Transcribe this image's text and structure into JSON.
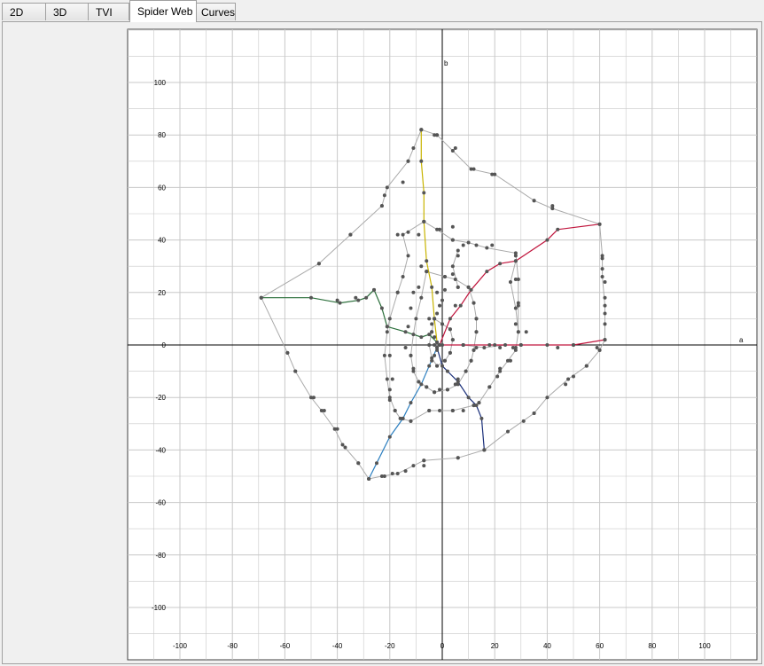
{
  "tabs": [
    {
      "label": "2D",
      "active": false
    },
    {
      "label": "3D",
      "active": false
    },
    {
      "label": "TVI",
      "active": false
    },
    {
      "label": "Spider Web",
      "active": true
    },
    {
      "label": "Curves",
      "active": false
    }
  ],
  "chart_data": {
    "type": "scatter",
    "title": "",
    "xlabel": "a",
    "ylabel": "b",
    "xlim": [
      -120,
      120
    ],
    "ylim": [
      -120,
      120
    ],
    "x_ticks": [
      -100,
      -80,
      -60,
      -40,
      -20,
      0,
      20,
      40,
      60,
      80,
      100
    ],
    "y_ticks": [
      100,
      80,
      60,
      40,
      20,
      0,
      -20,
      -40,
      -60,
      -80,
      -100
    ],
    "grid": true,
    "colors": {
      "grid": "#c8c8c8",
      "axis": "#000000",
      "web": "#aaaaaa",
      "point": "#555555",
      "yellow": "#c8b400",
      "red": "#c0143c",
      "green": "#2a6e3a",
      "blue": "#2c7fc0",
      "navy": "#1a2f7a"
    },
    "series": [
      {
        "color": "red",
        "points": [
          [
            -1,
            0
          ],
          [
            3,
            10
          ],
          [
            7,
            15
          ],
          [
            11,
            21
          ],
          [
            17,
            28
          ],
          [
            22,
            31
          ],
          [
            28,
            32
          ],
          [
            40,
            40
          ],
          [
            44,
            44
          ],
          [
            60,
            46
          ]
        ]
      },
      {
        "color": "red",
        "points": [
          [
            -1,
            0
          ],
          [
            8,
            0
          ],
          [
            20,
            0
          ],
          [
            40,
            0
          ],
          [
            50,
            0
          ],
          [
            62,
            2
          ]
        ]
      },
      {
        "color": "yellow",
        "points": [
          [
            -2,
            1
          ],
          [
            -3,
            10
          ],
          [
            -4,
            22
          ],
          [
            -6,
            32
          ],
          [
            -7,
            47
          ],
          [
            -7,
            58
          ],
          [
            -8,
            70
          ],
          [
            -8,
            82
          ]
        ]
      },
      {
        "color": "green",
        "points": [
          [
            -2,
            1
          ],
          [
            -5,
            4
          ],
          [
            -8,
            3
          ],
          [
            -14,
            5
          ],
          [
            -21,
            7
          ],
          [
            -23,
            14
          ],
          [
            -26,
            21
          ],
          [
            -29,
            18
          ],
          [
            -32,
            17
          ],
          [
            -39,
            16
          ],
          [
            -50,
            18
          ],
          [
            -69,
            18
          ]
        ]
      },
      {
        "color": "blue",
        "points": [
          [
            -2,
            -1
          ],
          [
            -5,
            -8
          ],
          [
            -8,
            -15
          ],
          [
            -12,
            -22
          ],
          [
            -15,
            -28
          ],
          [
            -20,
            -35
          ],
          [
            -25,
            -45
          ],
          [
            -28,
            -51
          ]
        ]
      },
      {
        "color": "navy",
        "points": [
          [
            -2,
            -1
          ],
          [
            0,
            -8
          ],
          [
            2,
            -10
          ],
          [
            6,
            -14
          ],
          [
            10,
            -20
          ],
          [
            13,
            -23
          ],
          [
            15,
            -28
          ],
          [
            16,
            -40
          ]
        ]
      },
      {
        "color": "web",
        "points": [
          [
            -69,
            18
          ],
          [
            -47,
            31
          ],
          [
            -35,
            42
          ],
          [
            -23,
            53
          ],
          [
            -21,
            60
          ],
          [
            -13,
            70
          ],
          [
            -8,
            82
          ],
          [
            -2,
            80
          ],
          [
            4,
            74
          ],
          [
            11,
            67
          ],
          [
            20,
            65
          ],
          [
            35,
            55
          ],
          [
            42,
            52
          ],
          [
            60,
            46
          ],
          [
            61,
            34
          ],
          [
            61,
            26
          ],
          [
            62,
            15
          ],
          [
            62,
            2
          ],
          [
            60,
            -2
          ],
          [
            55,
            -8
          ],
          [
            48,
            -13
          ],
          [
            40,
            -20
          ],
          [
            35,
            -26
          ],
          [
            25,
            -33
          ],
          [
            16,
            -40
          ],
          [
            6,
            -43
          ],
          [
            -7,
            -44
          ],
          [
            -11,
            -46
          ],
          [
            -17,
            -49
          ],
          [
            -23,
            -50
          ],
          [
            -28,
            -51
          ],
          [
            -32,
            -45
          ],
          [
            -38,
            -38
          ],
          [
            -41,
            -32
          ],
          [
            -46,
            -25
          ],
          [
            -50,
            -20
          ],
          [
            -56,
            -10
          ],
          [
            -59,
            -3
          ],
          [
            -69,
            18
          ]
        ]
      },
      {
        "color": "web",
        "points": [
          [
            -7,
            47
          ],
          [
            -2,
            44
          ],
          [
            4,
            40
          ],
          [
            10,
            39
          ],
          [
            17,
            37
          ],
          [
            28,
            35
          ],
          [
            29,
            25
          ],
          [
            29,
            15
          ],
          [
            29,
            5
          ],
          [
            28,
            -2
          ],
          [
            25,
            -6
          ],
          [
            22,
            -10
          ],
          [
            18,
            -16
          ],
          [
            14,
            -22
          ],
          [
            12,
            -23
          ],
          [
            4,
            -25
          ],
          [
            -5,
            -25
          ],
          [
            -12,
            -29
          ],
          [
            -16,
            -28
          ],
          [
            -18,
            -25
          ],
          [
            -20,
            -20
          ],
          [
            -21,
            -13
          ],
          [
            -22,
            -4
          ],
          [
            -21,
            5
          ],
          [
            -20,
            10
          ],
          [
            -17,
            20
          ],
          [
            -15,
            26
          ],
          [
            -13,
            34
          ],
          [
            -15,
            42
          ],
          [
            -7,
            47
          ]
        ]
      },
      {
        "color": "web",
        "points": [
          [
            -6,
            28
          ],
          [
            1,
            26
          ],
          [
            5,
            25
          ],
          [
            10,
            22
          ],
          [
            12,
            16
          ],
          [
            13,
            10
          ],
          [
            13,
            5
          ],
          [
            12,
            -2
          ],
          [
            11,
            -6
          ],
          [
            9,
            -10
          ],
          [
            6,
            -15
          ],
          [
            2,
            -17
          ],
          [
            -3,
            -18
          ],
          [
            -6,
            -16
          ],
          [
            -9,
            -14
          ],
          [
            -11,
            -10
          ],
          [
            -12,
            -4
          ],
          [
            -11,
            4
          ],
          [
            -10,
            10
          ],
          [
            -8,
            18
          ],
          [
            -6,
            28
          ]
        ]
      },
      {
        "color": "web",
        "points": [
          [
            -3,
            10
          ],
          [
            0,
            8
          ],
          [
            3,
            6
          ],
          [
            4,
            2
          ],
          [
            3,
            -3
          ],
          [
            1,
            -6
          ],
          [
            -2,
            -8
          ],
          [
            -4,
            -5
          ],
          [
            -5,
            0
          ],
          [
            -4,
            5
          ],
          [
            -3,
            10
          ]
        ]
      },
      {
        "color": "web",
        "points": [
          [
            0,
            0
          ],
          [
            8,
            0
          ],
          [
            16,
            -1
          ],
          [
            24,
            0
          ],
          [
            30,
            0
          ]
        ]
      },
      {
        "color": "web",
        "points": [
          [
            28,
            32
          ],
          [
            26,
            24
          ],
          [
            28,
            14
          ],
          [
            29,
            5
          ]
        ]
      },
      {
        "color": "web",
        "points": [
          [
            6,
            36
          ],
          [
            4,
            30
          ],
          [
            6,
            22
          ]
        ]
      }
    ],
    "extra_points": [
      [
        -8,
        82
      ],
      [
        -11,
        75
      ],
      [
        -13,
        70
      ],
      [
        -15,
        62
      ],
      [
        -22,
        57
      ],
      [
        -23,
        53
      ],
      [
        -35,
        42
      ],
      [
        -47,
        31
      ],
      [
        -40,
        17
      ],
      [
        -33,
        18
      ],
      [
        -26,
        21
      ],
      [
        -21,
        7
      ],
      [
        -17,
        20
      ],
      [
        -3,
        80
      ],
      [
        -2,
        80
      ],
      [
        5,
        75
      ],
      [
        12,
        67
      ],
      [
        19,
        65
      ],
      [
        35,
        55
      ],
      [
        42,
        53
      ],
      [
        61,
        33
      ],
      [
        61,
        29
      ],
      [
        62,
        24
      ],
      [
        62,
        18
      ],
      [
        62,
        12
      ],
      [
        62,
        8
      ],
      [
        62,
        2
      ],
      [
        60,
        -2
      ],
      [
        59,
        -1
      ],
      [
        55,
        -8
      ],
      [
        50,
        -12
      ],
      [
        47,
        -15
      ],
      [
        35,
        -26
      ],
      [
        31,
        -29
      ],
      [
        16,
        -40
      ],
      [
        6,
        -43
      ],
      [
        -7,
        -44
      ],
      [
        -7,
        -46
      ],
      [
        -14,
        -48
      ],
      [
        -19,
        -49
      ],
      [
        -22,
        -50
      ],
      [
        -28,
        -51
      ],
      [
        -32,
        -45
      ],
      [
        -37,
        -39
      ],
      [
        -40,
        -32
      ],
      [
        -45,
        -25
      ],
      [
        -49,
        -20
      ],
      [
        -56,
        -10
      ],
      [
        -59,
        -3
      ],
      [
        -17,
        42
      ],
      [
        -13,
        43
      ],
      [
        -9,
        42
      ],
      [
        -1,
        44
      ],
      [
        4,
        45
      ],
      [
        13,
        38
      ],
      [
        19,
        38
      ],
      [
        28,
        34
      ],
      [
        28,
        25
      ],
      [
        29,
        16
      ],
      [
        28,
        8
      ],
      [
        32,
        5
      ],
      [
        28,
        -1
      ],
      [
        26,
        -6
      ],
      [
        22,
        -9
      ],
      [
        21,
        -12
      ],
      [
        18,
        -16
      ],
      [
        14,
        -22
      ],
      [
        12,
        -23
      ],
      [
        8,
        -25
      ],
      [
        4,
        -25
      ],
      [
        -1,
        -25
      ],
      [
        -5,
        -25
      ],
      [
        -12,
        -29
      ],
      [
        -15,
        -28
      ],
      [
        -18,
        -25
      ],
      [
        -20,
        -21
      ],
      [
        -20,
        -17
      ],
      [
        -19,
        -13
      ],
      [
        -20,
        -4
      ],
      [
        -14,
        -1
      ],
      [
        -13,
        7
      ],
      [
        -12,
        14
      ],
      [
        -11,
        20
      ],
      [
        -9,
        22
      ],
      [
        -8,
        30
      ],
      [
        -6,
        28
      ],
      [
        1,
        26
      ],
      [
        4,
        27
      ],
      [
        10,
        22
      ],
      [
        12,
        16
      ],
      [
        13,
        10
      ],
      [
        13,
        5
      ],
      [
        12,
        -2
      ],
      [
        11,
        -6
      ],
      [
        9,
        -10
      ],
      [
        6,
        -13
      ],
      [
        5,
        -15
      ],
      [
        2,
        -17
      ],
      [
        -1,
        -17
      ],
      [
        -3,
        -18
      ],
      [
        -6,
        -16
      ],
      [
        -9,
        -14
      ],
      [
        -11,
        -9
      ],
      [
        -12,
        -4
      ],
      [
        -5,
        10
      ],
      [
        -4,
        8
      ],
      [
        -4,
        5
      ],
      [
        -3,
        3
      ],
      [
        -3,
        0
      ],
      [
        -2,
        -2
      ],
      [
        -3,
        -4
      ],
      [
        -4,
        -6
      ],
      [
        -2,
        -8
      ],
      [
        1,
        -6
      ],
      [
        3,
        -3
      ],
      [
        4,
        2
      ],
      [
        3,
        6
      ],
      [
        0,
        8
      ],
      [
        -2,
        12
      ],
      [
        -1,
        15
      ],
      [
        0,
        17
      ],
      [
        -2,
        20
      ],
      [
        1,
        21
      ],
      [
        5,
        15
      ],
      [
        8,
        0
      ],
      [
        13,
        -1
      ],
      [
        18,
        0
      ],
      [
        22,
        -1
      ],
      [
        27,
        -1
      ],
      [
        30,
        0
      ],
      [
        44,
        -1
      ],
      [
        50,
        0
      ],
      [
        4,
        40
      ],
      [
        6,
        34
      ],
      [
        8,
        38
      ],
      [
        6,
        22
      ]
    ]
  }
}
